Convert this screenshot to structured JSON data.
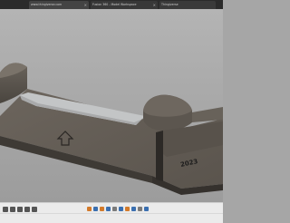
{
  "browser": {
    "tabs": [
      {
        "label": "www.thingiverse.com"
      },
      {
        "label": "Fusion 360 - Model Workspace"
      },
      {
        "label": "Thingiverse"
      }
    ],
    "close_glyph": "×"
  },
  "viewport": {
    "emboss_text": "2023",
    "model_color": "#5f5952"
  },
  "timeline": {
    "controls": [
      "first-icon",
      "previous-icon",
      "play-icon",
      "next-icon",
      "last-icon"
    ],
    "feature_colors": [
      "#d37a2a",
      "#3a6fb0",
      "#d37a2a",
      "#3a6fb0",
      "#7a7a7a",
      "#3a6fb0",
      "#d37a2a",
      "#3a6fb0",
      "#7a7a7a",
      "#3a6fb0"
    ]
  }
}
